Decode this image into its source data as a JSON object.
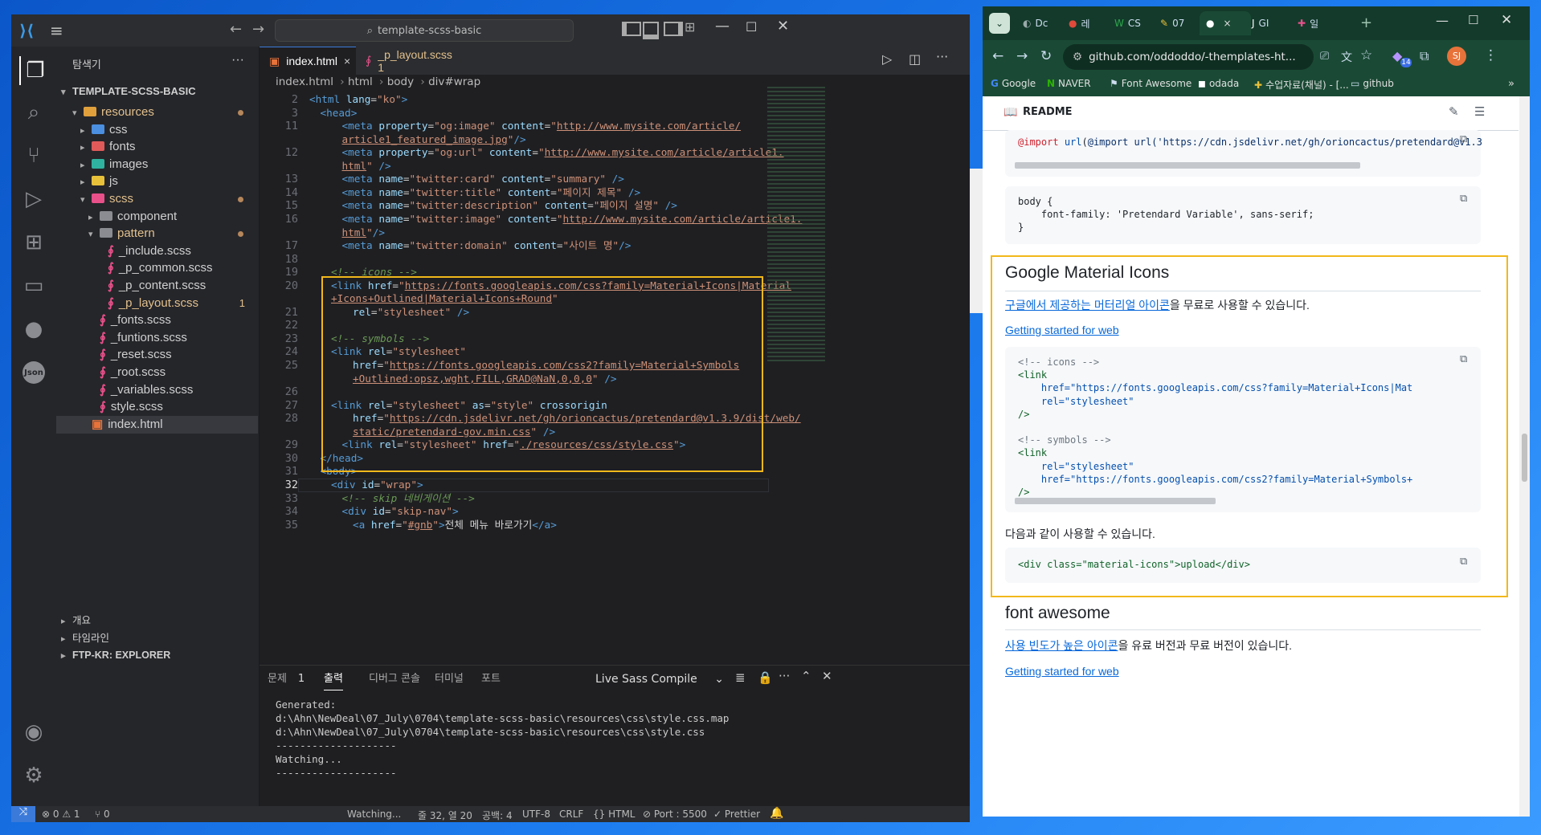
{
  "vscode": {
    "search": "template-scss-basic",
    "explorer_title": "탐색기",
    "explorer_more": "···",
    "root": "TEMPLATE-SCSS-BASIC",
    "tree": [
      {
        "label": "resources",
        "depth": 1,
        "kind": "folder-open",
        "color": "#e0a03c",
        "mod": true,
        "text_color": "#e2c08d"
      },
      {
        "label": "css",
        "depth": 2,
        "kind": "folder",
        "color": "#4b8fe0"
      },
      {
        "label": "fonts",
        "depth": 2,
        "kind": "folder",
        "color": "#e05a5a"
      },
      {
        "label": "images",
        "depth": 2,
        "kind": "folder",
        "color": "#2fb3a0"
      },
      {
        "label": "js",
        "depth": 2,
        "kind": "folder",
        "color": "#e8c13a"
      },
      {
        "label": "scss",
        "depth": 2,
        "kind": "folder-open",
        "color": "#e8508a",
        "mod": true,
        "text_color": "#e2c08d"
      },
      {
        "label": "component",
        "depth": 3,
        "kind": "folder",
        "color": "#8a8c91"
      },
      {
        "label": "pattern",
        "depth": 3,
        "kind": "folder-open",
        "color": "#8a8c91",
        "mod": true,
        "text_color": "#e2c08d"
      },
      {
        "label": "_include.scss",
        "depth": 4,
        "kind": "sass"
      },
      {
        "label": "_p_common.scss",
        "depth": 4,
        "kind": "sass"
      },
      {
        "label": "_p_content.scss",
        "depth": 4,
        "kind": "sass"
      },
      {
        "label": "_p_layout.scss",
        "depth": 4,
        "kind": "sass",
        "badge": "1",
        "text_color": "#e2c08d"
      },
      {
        "label": "_fonts.scss",
        "depth": 3,
        "kind": "sass"
      },
      {
        "label": "_funtions.scss",
        "depth": 3,
        "kind": "sass"
      },
      {
        "label": "_reset.scss",
        "depth": 3,
        "kind": "sass"
      },
      {
        "label": "_root.scss",
        "depth": 3,
        "kind": "sass"
      },
      {
        "label": "_variables.scss",
        "depth": 3,
        "kind": "sass"
      },
      {
        "label": "style.scss",
        "depth": 3,
        "kind": "sass"
      },
      {
        "label": "index.html",
        "depth": 2,
        "kind": "html",
        "selected": true
      }
    ],
    "bottom_sections": [
      "개요",
      "타임라인",
      "FTP-KR: EXPLORER"
    ],
    "tabs": [
      {
        "label": "index.html",
        "active": true,
        "close": "×"
      },
      {
        "label": "_p_layout.scss 1",
        "active": false
      }
    ],
    "breadcrumb": [
      "index.html",
      "html",
      "body",
      "div#wrap"
    ],
    "code_lines": [
      {
        "n": "2",
        "html": "<span class='tag'>&lt;html</span> <span class='attr'>lang</span>=<span class='str'>\"ko\"</span><span class='tag'>&gt;</span>",
        "indent": 0
      },
      {
        "n": "3",
        "html": "<span class='tag'>&lt;head&gt;</span>",
        "indent": 1
      },
      {
        "n": "11",
        "html": "<span class='tag'>&lt;meta</span> <span class='attr'>property</span>=<span class='str'>\"og:image\"</span> <span class='attr'>content</span>=<span class='str'>\"<span class='lnk'>http://www.mysite.com/article/</span></span>",
        "indent": 3
      },
      {
        "n": "",
        "html": "<span class='lnk'>article1_featured_image.jpg</span><span class='str'>\"</span><span class='tag'>/&gt;</span>",
        "indent": 3
      },
      {
        "n": "12",
        "html": "<span class='tag'>&lt;meta</span> <span class='attr'>property</span>=<span class='str'>\"og:url\"</span> <span class='attr'>content</span>=<span class='str'>\"<span class='lnk'>http://www.mysite.com/article/article1.</span></span>",
        "indent": 3
      },
      {
        "n": "",
        "html": "<span class='lnk'>html</span><span class='str'>\"</span> <span class='tag'>/&gt;</span>",
        "indent": 3
      },
      {
        "n": "13",
        "html": "<span class='tag'>&lt;meta</span> <span class='attr'>name</span>=<span class='str'>\"twitter:card\"</span> <span class='attr'>content</span>=<span class='str'>\"summary\"</span> <span class='tag'>/&gt;</span>",
        "indent": 3
      },
      {
        "n": "14",
        "html": "<span class='tag'>&lt;meta</span> <span class='attr'>name</span>=<span class='str'>\"twitter:title\"</span> <span class='attr'>content</span>=<span class='str'>\"페이지 제목\"</span> <span class='tag'>/&gt;</span>",
        "indent": 3
      },
      {
        "n": "15",
        "html": "<span class='tag'>&lt;meta</span> <span class='attr'>name</span>=<span class='str'>\"twitter:description\"</span> <span class='attr'>content</span>=<span class='str'>\"페이지 설명\"</span> <span class='tag'>/&gt;</span>",
        "indent": 3
      },
      {
        "n": "16",
        "html": "<span class='tag'>&lt;meta</span> <span class='attr'>name</span>=<span class='str'>\"twitter:image\"</span> <span class='attr'>content</span>=<span class='str'>\"<span class='lnk'>http://www.mysite.com/article/article1.</span></span>",
        "indent": 3
      },
      {
        "n": "",
        "html": "<span class='lnk'>html</span><span class='str'>\"</span><span class='tag'>/&gt;</span>",
        "indent": 3
      },
      {
        "n": "17",
        "html": "<span class='tag'>&lt;meta</span> <span class='attr'>name</span>=<span class='str'>\"twitter:domain\"</span> <span class='attr'>content</span>=<span class='str'>\"사이트 명\"</span><span class='tag'>/&gt;</span>",
        "indent": 3
      },
      {
        "n": "18",
        "html": "",
        "indent": 0
      },
      {
        "n": "19",
        "html": "<span class='cmt'>&lt;!-- icons --&gt;</span>",
        "indent": 2
      },
      {
        "n": "20",
        "html": "<span class='tag'>&lt;link</span> <span class='attr'>href</span>=<span class='str'>\"<span class='lnk'>https://fonts.googleapis.com/css?family=Material+Icons|Material</span></span>",
        "indent": 2
      },
      {
        "n": "",
        "html": "<span class='lnk'>+Icons+Outlined|Material+Icons+Round</span><span class='str'>\"</span>",
        "indent": 2
      },
      {
        "n": "21",
        "html": "<span class='attr'>rel</span>=<span class='str'>\"stylesheet\"</span> <span class='tag'>/&gt;</span>",
        "indent": 4
      },
      {
        "n": "22",
        "html": "",
        "indent": 0
      },
      {
        "n": "23",
        "html": "<span class='cmt'>&lt;!-- symbols --&gt;</span>",
        "indent": 2
      },
      {
        "n": "24",
        "html": "<span class='tag'>&lt;link</span> <span class='attr'>rel</span>=<span class='str'>\"stylesheet\"</span>",
        "indent": 2
      },
      {
        "n": "25",
        "html": "<span class='attr'>href</span>=<span class='str'>\"<span class='lnk'>https://fonts.googleapis.com/css2?family=Material+Symbols</span></span>",
        "indent": 4
      },
      {
        "n": "",
        "html": "<span class='lnk'>+Outlined:opsz,wght,FILL,GRAD@NaN,0,0,0</span><span class='str'>\"</span> <span class='tag'>/&gt;</span>",
        "indent": 4
      },
      {
        "n": "26",
        "html": "",
        "indent": 0
      },
      {
        "n": "27",
        "html": "<span class='tag'>&lt;link</span> <span class='attr'>rel</span>=<span class='str'>\"stylesheet\"</span> <span class='attr'>as</span>=<span class='str'>\"style\"</span> <span class='attr'>crossorigin</span>",
        "indent": 2
      },
      {
        "n": "28",
        "html": "<span class='attr'>href</span>=<span class='str'>\"<span class='lnk'>https://cdn.jsdelivr.net/gh/orioncactus/pretendard@v1.3.9/dist/web/</span></span>",
        "indent": 4
      },
      {
        "n": "",
        "html": "<span class='lnk'>static/pretendard-gov.min.css</span><span class='str'>\"</span> <span class='tag'>/&gt;</span>",
        "indent": 4
      },
      {
        "n": "29",
        "html": "<span class='tag'>&lt;link</span> <span class='attr'>rel</span>=<span class='str'>\"stylesheet\"</span> <span class='attr'>href</span>=<span class='str'>\"<span class='lnk'>./resources/css/style.css</span>\"</span><span class='tag'>&gt;</span>",
        "indent": 3
      },
      {
        "n": "30",
        "html": "<span class='tag'>&lt;/head&gt;</span>",
        "indent": 1
      },
      {
        "n": "31",
        "html": "<span class='tag'>&lt;body&gt;</span>",
        "indent": 1
      },
      {
        "n": "32",
        "html": "<span class='tag'>&lt;div</span> <span class='attr'>id</span>=<span class='str'>\"wrap\"</span><span class='tag'>&gt;</span>",
        "indent": 2,
        "current": true
      },
      {
        "n": "33",
        "html": "<span class='cmt'>&lt;!-- skip 네비게이션 --&gt;</span>",
        "indent": 3
      },
      {
        "n": "34",
        "html": "<span class='tag'>&lt;div</span> <span class='attr'>id</span>=<span class='str'>\"skip-nav\"</span><span class='tag'>&gt;</span>",
        "indent": 3
      },
      {
        "n": "35",
        "html": "<span class='tag'>&lt;a</span> <span class='attr'>href</span>=<span class='str'>\"<span class='lnk'>#gnb</span>\"</span><span class='tag'>&gt;</span><span class='txt'>전체 메뉴 바로가기</span><span class='tag'>&lt;/a&gt;</span>",
        "indent": 4
      }
    ],
    "panel_tabs": [
      {
        "label": "문제",
        "badge": "1"
      },
      {
        "label": "출력",
        "active": true
      },
      {
        "label": "디버그 콘솔"
      },
      {
        "label": "터미널"
      },
      {
        "label": "포트"
      }
    ],
    "panel_select": "Live Sass Compile",
    "output_lines": [
      "Generated:",
      "d:\\Ahn\\NewDeal\\07_July\\0704\\template-scss-basic\\resources\\css\\style.css.map",
      "d:\\Ahn\\NewDeal\\07_July\\0704\\template-scss-basic\\resources\\css\\style.css",
      "--------------------",
      "Watching...",
      "--------------------"
    ],
    "status": {
      "errors": "⊗ 0 ⚠ 1",
      "ports": "⑂ 0",
      "watching": "Watching...",
      "position": "줄 32, 열 20",
      "spaces": "공백: 4",
      "encoding": "UTF-8",
      "eol": "CRLF",
      "lang": "{} HTML",
      "port": "⊘ Port : 5500",
      "prettier": "✓ Prettier"
    }
  },
  "chrome": {
    "tabs": [
      {
        "label": "Dc"
      },
      {
        "label": "레"
      },
      {
        "label": "CS"
      },
      {
        "label": "07"
      },
      {
        "label": "",
        "active": true,
        "close": "×"
      },
      {
        "label": "GI"
      },
      {
        "label": "일"
      }
    ],
    "new_tab": "+",
    "url": "github.com/oddoddo/-themplates-ht...",
    "profile": "SJ",
    "ext_badge": "14",
    "bookmarks": [
      "Google",
      "NAVER",
      "Font Awesome",
      "odada",
      "수업자료(채널) - [...",
      "github"
    ],
    "readme_label": "README",
    "import_line": "@import url('https://cdn.jsdelivr.net/gh/orioncactus/pretendard@v1.3",
    "body_css": [
      "body {",
      "    font-family: 'Pretendard Variable', sans-serif;",
      "}"
    ],
    "section1_title": "Google Material Icons",
    "section1_link": "구글에서 제공하는 머터리얼 아이콘",
    "section1_rest": "을 무료로 사용할 수 있습니다.",
    "getting_started": "Getting started for web",
    "code2": [
      "<!-- icons -->",
      "<link",
      "    href=\"https://fonts.googleapis.com/css?family=Material+Icons|Mat",
      "    rel=\"stylesheet\"",
      "/>",
      "",
      "<!-- symbols -->",
      "<link",
      "    rel=\"stylesheet\"",
      "    href=\"https://fonts.googleapis.com/css2?family=Material+Symbols+",
      "/>"
    ],
    "usage_text": "다음과 같이 사용할 수 있습니다.",
    "usage_code": "<div class=\"material-icons\">upload</div>",
    "section2_title": "font awesome",
    "section2_link": "사용 빈도가 높은 아이콘",
    "section2_rest": "을 유료 버전과 무료 버전이 있습니다.",
    "getting_started2": "Getting started for web"
  },
  "colors": {
    "highlight": "#f2b81b",
    "accent": "#0969da"
  }
}
